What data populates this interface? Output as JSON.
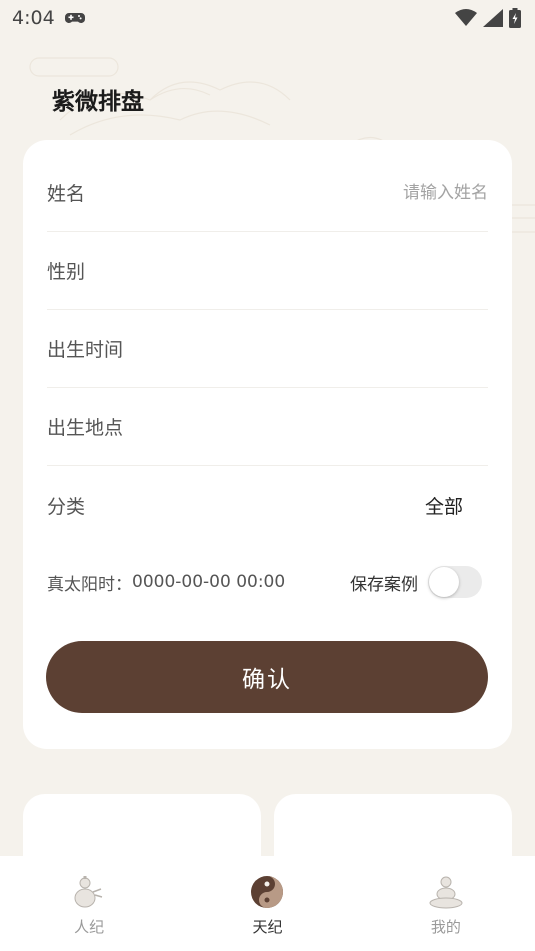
{
  "status_bar": {
    "time": "4:04"
  },
  "header": {
    "title": "紫微排盘"
  },
  "form": {
    "name": {
      "label": "姓名",
      "placeholder": "请输入姓名",
      "value": ""
    },
    "gender": {
      "label": "性别",
      "value": ""
    },
    "birth_time": {
      "label": "出生时间",
      "value": ""
    },
    "birth_place": {
      "label": "出生地点",
      "value": ""
    },
    "category": {
      "label": "分类",
      "value": "全部"
    },
    "solar_time": {
      "label": "真太阳时：",
      "value": "0000-00-00 00:00"
    },
    "save_case": {
      "label": "保存案例",
      "enabled": false
    },
    "confirm_label": "确认"
  },
  "tabbar": {
    "items": [
      {
        "label": "人纪",
        "icon": "gourd-icon",
        "active": false
      },
      {
        "label": "天纪",
        "icon": "yin-yang-icon",
        "active": true
      },
      {
        "label": "我的",
        "icon": "buddha-icon",
        "active": false
      }
    ]
  },
  "colors": {
    "background": "#f5f2ec",
    "card": "#ffffff",
    "accent": "#5c4033",
    "text_primary": "#222222",
    "text_secondary": "#555555",
    "placeholder": "#a3a3a3"
  }
}
